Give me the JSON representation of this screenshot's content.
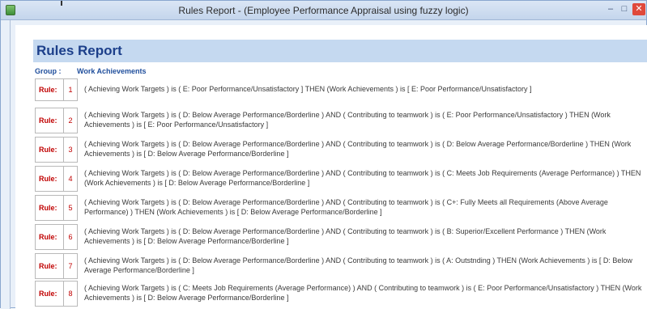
{
  "window": {
    "title": "Rules Report - (Employee Performance Appraisal using fuzzy logic)"
  },
  "report": {
    "title": "Rules Report",
    "group_label": "Group :",
    "group_value": "Work Achievements",
    "rule_label": "Rule:",
    "rules": [
      {
        "num": "1",
        "text": "( Achieving Work Targets ) is ( E: Poor Performance/Unsatisfactory ] THEN (Work Achievements ) is [ E: Poor Performance/Unsatisfactory ]"
      },
      {
        "num": "2",
        "text": "( Achieving Work Targets ) is ( D: Below Average Performance/Borderline ) AND ( Contributing to teamwork ) is ( E: Poor Performance/Unsatisfactory ) THEN (Work Achievements ) is [ E: Poor Performance/Unsatisfactory ]"
      },
      {
        "num": "3",
        "text": "( Achieving Work Targets ) is ( D: Below Average Performance/Borderline ) AND ( Contributing to teamwork ) is ( D: Below Average Performance/Borderline ) THEN (Work Achievements ) is [ D: Below Average Performance/Borderline ]"
      },
      {
        "num": "4",
        "text": "( Achieving Work Targets ) is ( D: Below Average Performance/Borderline ) AND ( Contributing to teamwork ) is ( C: Meets Job Requirements (Average Performance) ) THEN (Work Achievements ) is [ D: Below Average Performance/Borderline ]"
      },
      {
        "num": "5",
        "text": "( Achieving Work Targets ) is ( D: Below Average Performance/Borderline ) AND ( Contributing to teamwork ) is ( C+: Fully Meets all Requirements (Above Average Performance) ) THEN (Work Achievements ) is [ D: Below Average Performance/Borderline ]"
      },
      {
        "num": "6",
        "text": "( Achieving Work Targets ) is ( D: Below Average Performance/Borderline ) AND ( Contributing to teamwork ) is ( B: Superior/Excellent Performance ) THEN (Work Achievements ) is [ D: Below Average Performance/Borderline ]"
      },
      {
        "num": "7",
        "text": "( Achieving Work Targets ) is ( D: Below Average Performance/Borderline ) AND ( Contributing to teamwork ) is ( A: Outstnding ) THEN (Work Achievements ) is [ D: Below Average Performance/Borderline ]"
      },
      {
        "num": "8",
        "text": "( Achieving Work Targets ) is ( C: Meets Job Requirements (Average Performance) ) AND ( Contributing to teamwork ) is ( E: Poor Performance/Unsatisfactory ) THEN (Work Achievements ) is [ D: Below Average Performance/Borderline ]"
      }
    ]
  },
  "colors": {
    "title_blue": "#1c3f8a",
    "header_band": "#c5d9f0",
    "rule_red": "#c00000"
  },
  "icons": {
    "app": "app-icon",
    "minimize": "minimize-icon",
    "maximize": "maximize-icon",
    "close": "close-icon"
  }
}
